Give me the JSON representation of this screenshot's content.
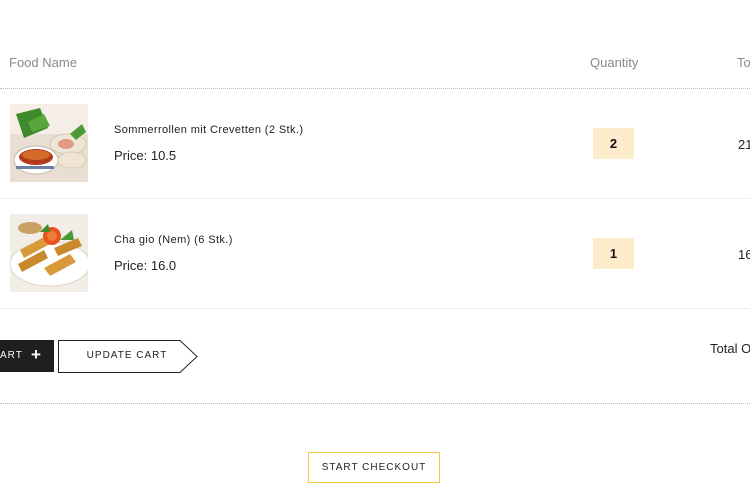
{
  "table": {
    "headers": {
      "food_name": "Food Name",
      "quantity": "Quantity",
      "total": "To"
    },
    "items": [
      {
        "name": "Sommerrollen mit Crevetten (2 Stk.)",
        "price": "Price: 10.5",
        "quantity": "2",
        "total": "21",
        "image_icon": "summer-rolls-photo"
      },
      {
        "name": "Cha gio (Nem) (6 Stk.)",
        "price": "Price: 16.0",
        "quantity": "1",
        "total": "16",
        "image_icon": "spring-rolls-photo"
      }
    ]
  },
  "actions": {
    "continue_label": "ART",
    "continue_icon": "plus-icon",
    "update_label": "UPDATE CART",
    "total_label": "Total O",
    "checkout_label": "START CHECKOUT"
  },
  "colors": {
    "quantity_bg": "#fdeccb",
    "checkout_border": "#f3c742",
    "dark_button": "#1f1f1f"
  }
}
